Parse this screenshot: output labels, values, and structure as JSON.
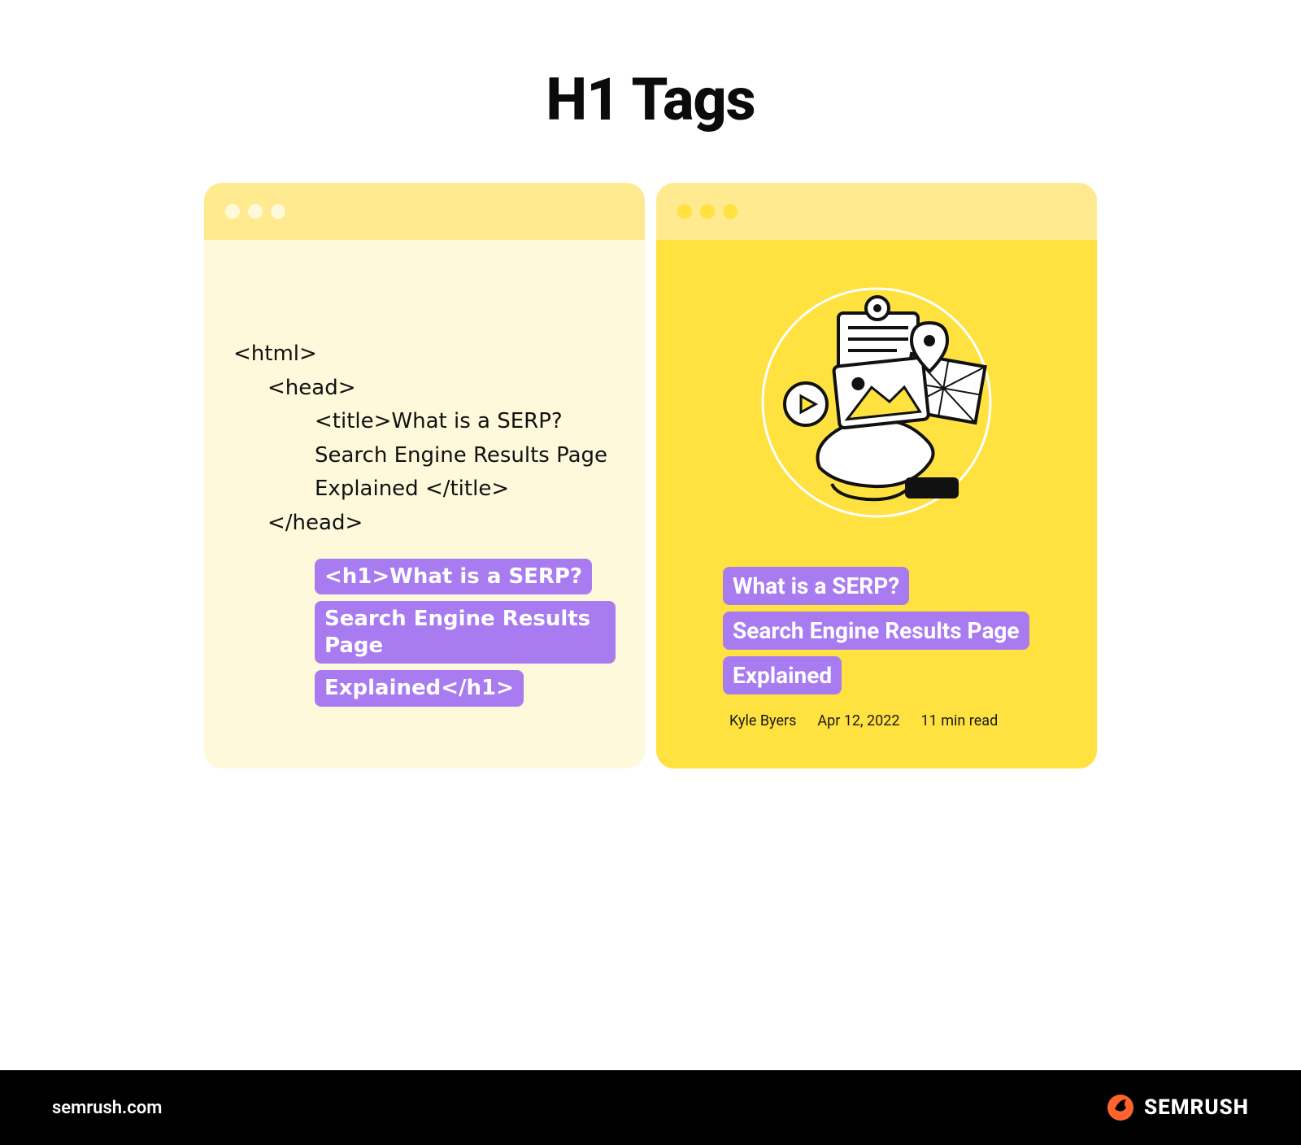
{
  "title": "H1 Tags",
  "code": {
    "html_open": "<html>",
    "head_open": "<head>",
    "title_line1": "<title>What is a SERP?",
    "title_line2": "Search Engine Results Page",
    "title_line3": "Explained </title>",
    "head_close": "</head>",
    "h1_line1": "<h1>What is a SERP?",
    "h1_line2": "Search Engine Results Page",
    "h1_line3": "Explained</h1>"
  },
  "article": {
    "headline_line1": "What is a SERP?",
    "headline_line2": "Search Engine Results Page",
    "headline_line3": "Explained",
    "author": "Kyle Byers",
    "date": "Apr 12, 2022",
    "read_time": "11 min read"
  },
  "footer": {
    "site": "semrush.com",
    "brand": "SEMRUSH"
  }
}
